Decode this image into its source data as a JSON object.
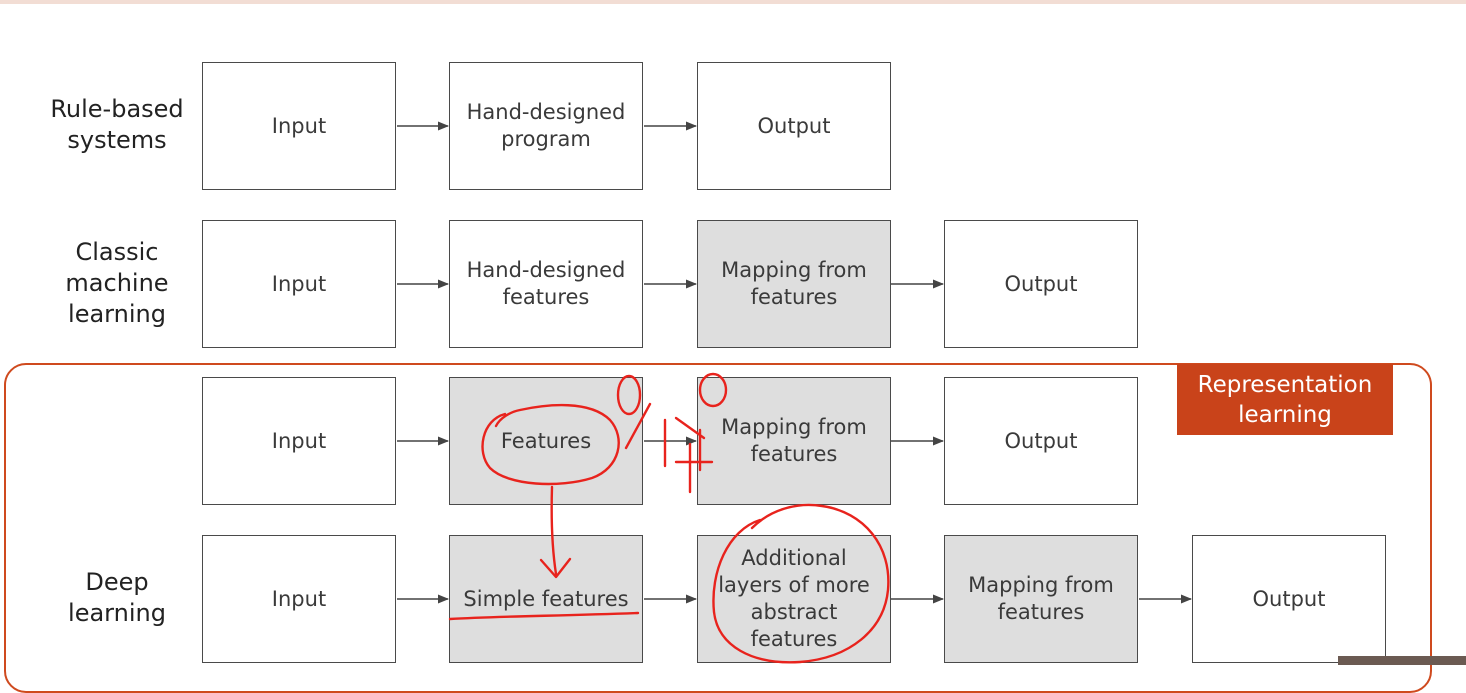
{
  "rows": [
    {
      "label": "Rule-based\nsystems",
      "boxes": [
        "Input",
        "Hand-designed\nprogram",
        "Output"
      ]
    },
    {
      "label": "Classic\nmachine\nlearning",
      "boxes": [
        "Input",
        "Hand-designed\nfeatures",
        "Mapping from\nfeatures",
        "Output"
      ]
    },
    {
      "boxes": [
        "Input",
        "Features",
        "Mapping from\nfeatures",
        "Output"
      ]
    },
    {
      "label": "Deep\nlearning",
      "boxes": [
        "Input",
        "Simple features",
        "Additional\nlayers of more\nabstract\nfeatures",
        "Mapping from\nfeatures",
        "Output"
      ]
    }
  ],
  "representation_badge": "Representation\nlearning",
  "colors": {
    "accent": "#c9431a",
    "shaded_box": "#dedede",
    "annotation_ink": "#e8231d"
  },
  "annotations": {
    "handwritten": "0/1 ?"
  }
}
